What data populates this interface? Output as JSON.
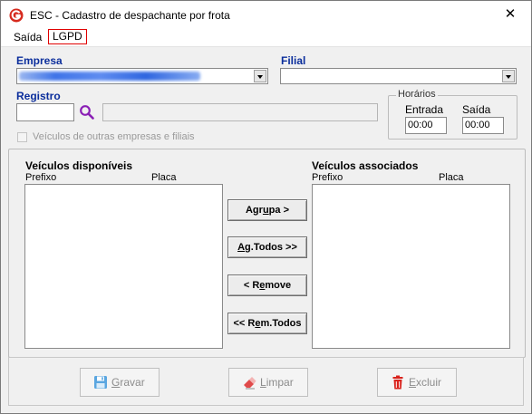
{
  "window": {
    "title": "ESC - Cadastro de despachante por frota",
    "close_glyph": "✕"
  },
  "menu": {
    "items": [
      "Saída",
      "LGPD"
    ]
  },
  "form": {
    "empresa_label": "Empresa",
    "filial_label": "Filial",
    "registro_label": "Registro",
    "registro_value": "",
    "registro_name_value": "",
    "horarios": {
      "title": "Horários",
      "entrada_label": "Entrada",
      "entrada_value": "00:00",
      "saida_label": "Saída",
      "saida_value": "00:00"
    },
    "outras_empresas_label": "Veículos de outras empresas e filiais"
  },
  "lists": {
    "disponiveis": {
      "title": "Veículos disponíveis",
      "col1": "Prefixo",
      "col2": "Placa",
      "rows": []
    },
    "associados": {
      "title": "Veículos associados",
      "col1": "Prefixo",
      "col2": "Placa",
      "rows": []
    }
  },
  "transfer_buttons": {
    "agrupa": {
      "pre": "Agr",
      "u": "u",
      "post": "pa >"
    },
    "ag_todos": {
      "pre": "",
      "u": "A",
      "post": "g.Todos >>"
    },
    "remove": {
      "pre": "< R",
      "u": "e",
      "post": "move"
    },
    "rem_todos": {
      "pre": "<< R",
      "u": "e",
      "post": "m.Todos"
    }
  },
  "actions": {
    "gravar": "Gravar",
    "limpar": "Limpar",
    "excluir": "Excluir"
  },
  "icons": {
    "app": "app-logo-icon",
    "search": "search-icon",
    "gravar": "floppy-disk-icon",
    "limpar": "eraser-icon",
    "excluir": "trash-icon"
  },
  "colors": {
    "label_blue": "#0b2e9c",
    "search_purple": "#8a1fb5",
    "lgpd_border": "#e00000"
  }
}
